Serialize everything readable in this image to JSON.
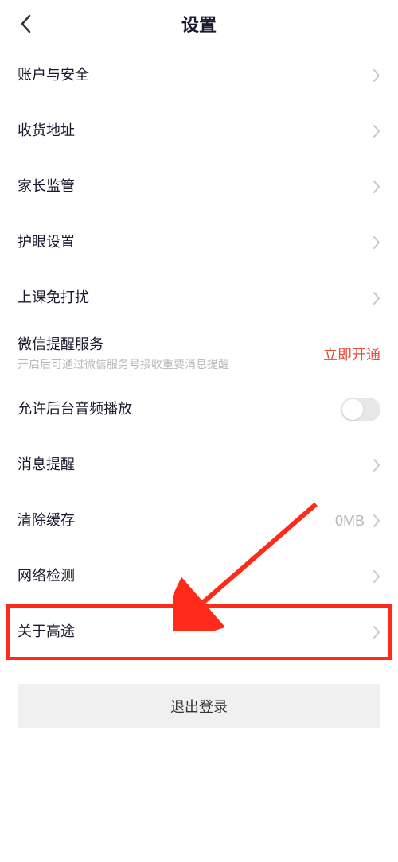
{
  "header": {
    "title": "设置"
  },
  "rows": {
    "account": {
      "label": "账户与安全"
    },
    "address": {
      "label": "收货地址"
    },
    "parental": {
      "label": "家长监管"
    },
    "eye": {
      "label": "护眼设置"
    },
    "dnd": {
      "label": "上课免打扰"
    },
    "wechat": {
      "label": "微信提醒服务",
      "sub": "开启后可通过微信服务号接收重要消息提醒",
      "action": "立即开通"
    },
    "bgaudio": {
      "label": "允许后台音频播放"
    },
    "notify": {
      "label": "消息提醒"
    },
    "cache": {
      "label": "清除缓存",
      "value": "0MB"
    },
    "network": {
      "label": "网络检测"
    },
    "about": {
      "label": "关于高途"
    }
  },
  "logout": {
    "label": "退出登录"
  }
}
